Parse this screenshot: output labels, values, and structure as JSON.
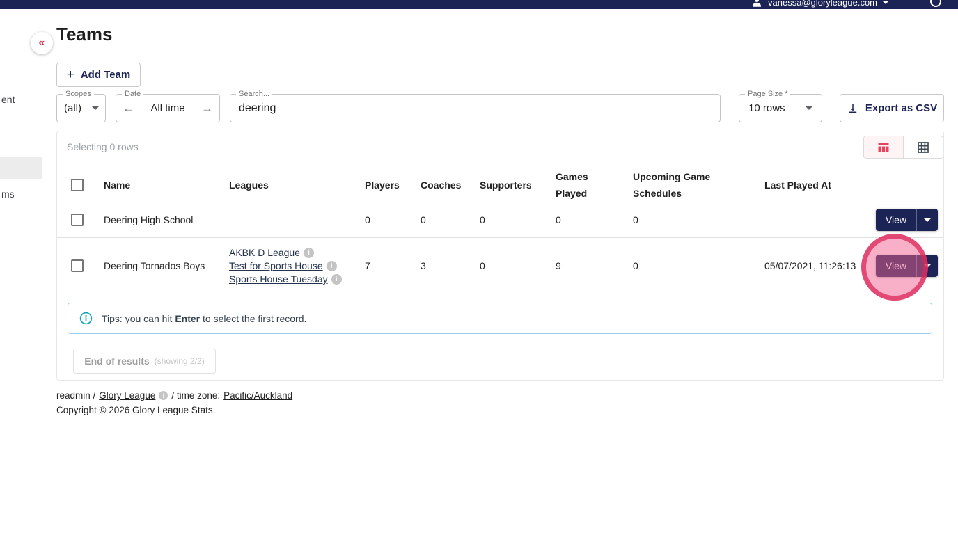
{
  "colors": {
    "navy": "#1b2455",
    "accent_red": "#e8415e",
    "annotation_pink": "#ed4a7b",
    "info_teal": "#0ca4b8"
  },
  "topbar": {
    "email": "vanessa@gloryleague.com"
  },
  "sidebar": {
    "partial_item_1": "ent",
    "partial_item_2": "ms"
  },
  "icons": {
    "plus": "+",
    "collapse": "«",
    "arrow_left": "←",
    "arrow_right": "→",
    "info_glyph": "i"
  },
  "page": {
    "title": "Teams"
  },
  "actions": {
    "add_team": "Add Team",
    "export_csv": "Export as CSV"
  },
  "filters": {
    "scopes_label": "Scopes",
    "scopes_value": "(all)",
    "date_label": "Date",
    "date_value": "All time",
    "search_label": "Search...",
    "search_value": "deering",
    "page_size_label": "Page Size *",
    "page_size_value": "10 rows"
  },
  "table": {
    "selecting_text": "Selecting 0 rows",
    "columns": [
      "Name",
      "Leagues",
      "Players",
      "Coaches",
      "Supporters",
      "Games Played",
      "Upcoming Game Schedules",
      "Last Played At"
    ]
  },
  "rows": [
    {
      "name": "Deering High School",
      "players": "0",
      "coaches": "0",
      "supporters": "0",
      "games_played": "0",
      "upcoming": "0",
      "last_played_at": "",
      "view_label": "View"
    },
    {
      "name": "Deering Tornados Boys",
      "leagues": [
        "AKBK D League",
        "Test for Sports House",
        "Sports House Tuesday"
      ],
      "players": "7",
      "coaches": "3",
      "supporters": "0",
      "games_played": "9",
      "upcoming": "0",
      "last_played_at": "05/07/2021, 11:26:13",
      "view_label": "View"
    }
  ],
  "tips": {
    "prefix": "Tips: you can hit ",
    "key": "Enter",
    "suffix": " to select the first record."
  },
  "results": {
    "end_text": "End of results",
    "showing_text": "(showing 2/2)"
  },
  "footer": {
    "prefix": "readmin /",
    "league_link": "Glory League",
    "mid": "/ time zone:",
    "timezone_link": "Pacific/Auckland",
    "copyright": "Copyright © 2026 Glory League Stats."
  }
}
